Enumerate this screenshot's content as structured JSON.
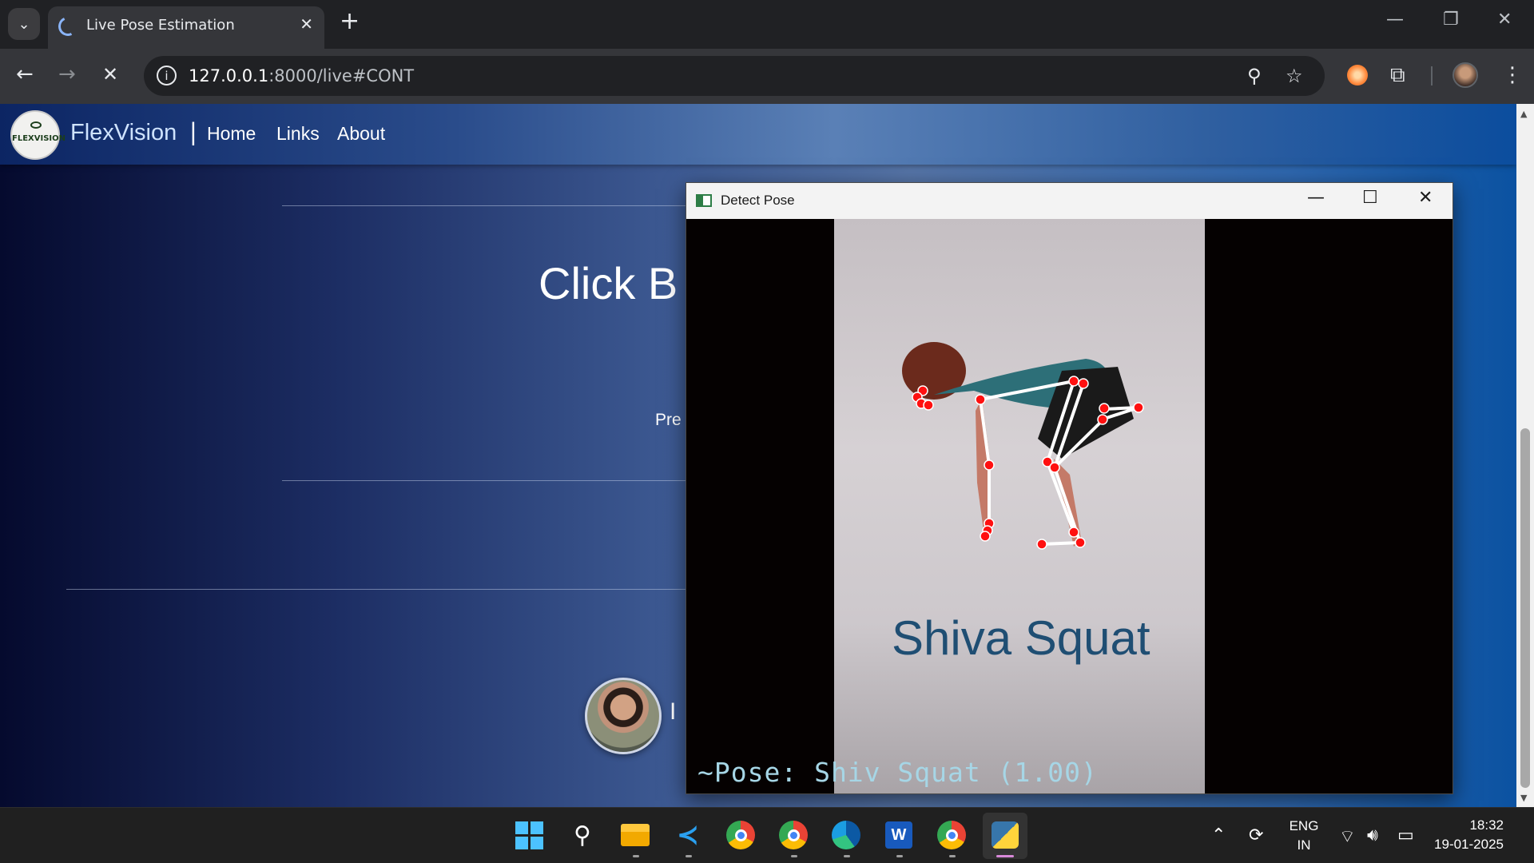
{
  "browser": {
    "tab_title": "Live Pose Estimation",
    "new_tab_glyph": "+",
    "url_host": "127.0.0.1",
    "url_rest": ":8000/live#CONT",
    "icons": [
      "tab-search-icon",
      "loading-spinner-icon",
      "close-icon",
      "back-icon",
      "forward-icon",
      "stop-loading-icon",
      "site-info-icon",
      "zoom-icon",
      "bookmark-star-icon",
      "extension-swirl-icon",
      "extensions-puzzle-icon",
      "profile-avatar",
      "menu-kebab-icon",
      "minimize-icon",
      "restore-icon",
      "close-window-icon"
    ]
  },
  "site": {
    "logo_text": "FLEXVISION",
    "brand": "FlexVision",
    "brand_separator": "|",
    "nav": [
      "Home",
      "Links",
      "About"
    ],
    "hero_title": "Click B",
    "hero_sub": "Pre",
    "author_text": "I"
  },
  "pose_window": {
    "title": "Detect Pose",
    "frame_caption": "Shiva Squat",
    "overlay_text": "~Pose: Shiv Squat (1.00)",
    "keypoint_color": "#ff1010",
    "skeleton_color": "#ffffff"
  },
  "taskbar": {
    "apps": [
      "windows-start-icon",
      "search-icon",
      "file-explorer-icon",
      "vscode-icon",
      "chrome-icon",
      "chrome-profile-icon",
      "edge-icon",
      "word-icon",
      "chrome-profile2-icon",
      "python-icon"
    ],
    "lang_line1": "ENG",
    "lang_line2": "IN",
    "time": "18:32",
    "date": "19-01-2025"
  }
}
